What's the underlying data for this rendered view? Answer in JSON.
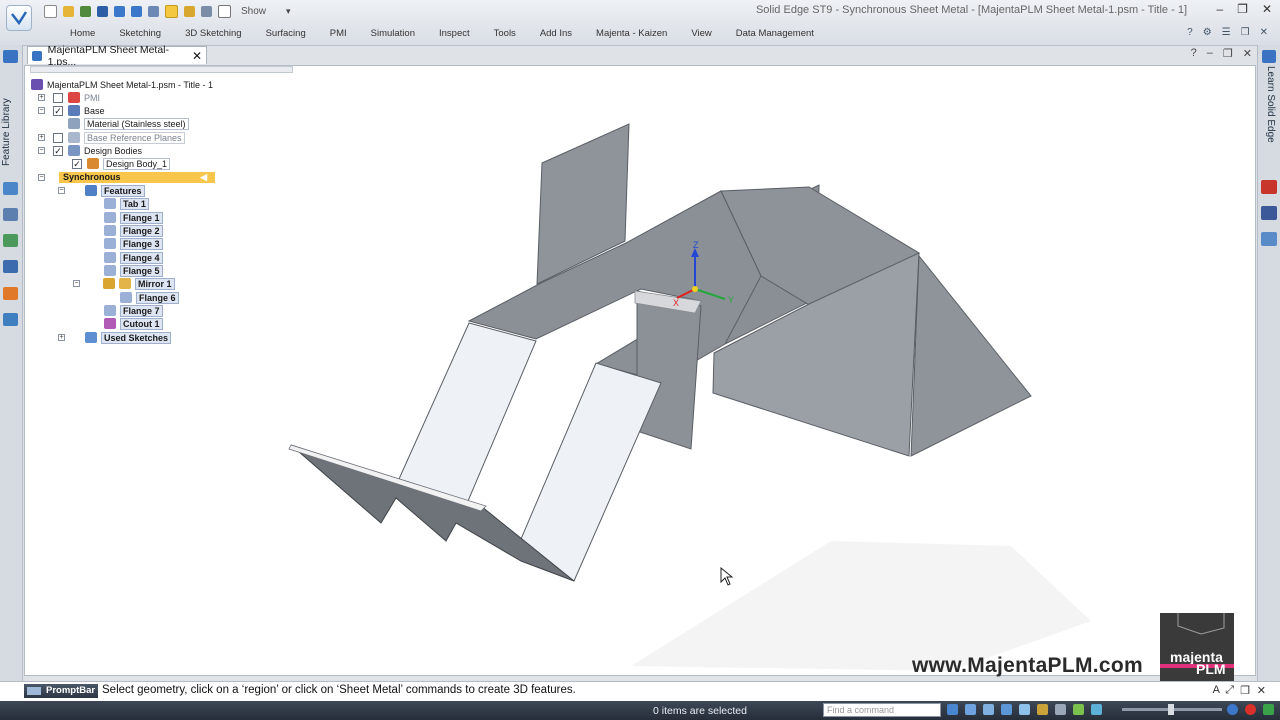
{
  "window": {
    "title": "Solid Edge ST9 - Synchronous Sheet Metal - [MajentaPLM Sheet Metal-1.psm - Title - 1]",
    "controls": [
      "‒",
      "❐",
      "✕"
    ]
  },
  "quick_access": {
    "show_label": "Show"
  },
  "ribbon": {
    "tabs": [
      "Home",
      "Sketching",
      "3D Sketching",
      "Surfacing",
      "PMI",
      "Simulation",
      "Inspect",
      "Tools",
      "Add Ins",
      "Majenta - Kaizen",
      "View",
      "Data Management"
    ],
    "right_icons": [
      "help-icon",
      "options-icon",
      "list-icon",
      "restore-icon",
      "close-icon"
    ]
  },
  "left_panel": {
    "label": "Feature Library"
  },
  "right_panel": {
    "label": "Learn Solid Edge"
  },
  "document_tab": {
    "label": "MajentaPLM Sheet Metal-1.ps...",
    "close": "✕"
  },
  "document_controls": [
    "?",
    "‒",
    "❐",
    "✕"
  ],
  "tree": {
    "root": "MajentaPLM Sheet Metal-1.psm - Title - 1",
    "pmi": "PMI",
    "base": "Base",
    "material": "Material (Stainless steel)",
    "base_ref_planes": "Base Reference Planes",
    "design_bodies": "Design Bodies",
    "design_body_1": "Design Body_1",
    "synchronous": "Synchronous",
    "features": "Features",
    "feature_items": [
      "Tab 1",
      "Flange 1",
      "Flange 2",
      "Flange 3",
      "Flange 4",
      "Flange 5"
    ],
    "mirror": "Mirror 1",
    "mirror_child": "Flange 6",
    "after_mirror": [
      "Flange 7",
      "Cutout 1"
    ],
    "used_sketches": "Used Sketches"
  },
  "viewport": {
    "triad": {
      "x": "X",
      "y": "Y",
      "z": "Z"
    }
  },
  "watermark": {
    "url": "www.MajentaPLM.com",
    "logo_line1": "majenta",
    "logo_line2": "PLM"
  },
  "prompt": {
    "label": "PromptBar",
    "text": "Select geometry, click on a ‘region’ or click on ‘Sheet Metal’ commands to create 3D features."
  },
  "status": {
    "selection": "0 items are selected",
    "command_finder_placeholder": "Find a command"
  },
  "colors": {
    "highlight": "#f7c64a",
    "ribbon_bg": "#e4e8ee",
    "status_bg": "#2f3844",
    "part_grey": "#8f949b",
    "accent_pink": "#e0307a"
  }
}
